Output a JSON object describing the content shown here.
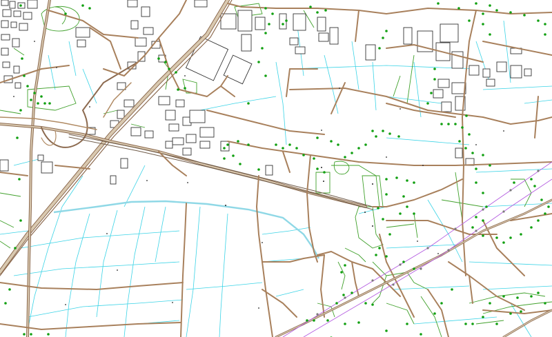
{
  "map": {
    "colors": {
      "background": "#ffffff",
      "road_casing": "#8c6a4f",
      "road_fill": "#d9c9b0",
      "major_road": "#b08a63",
      "minor_road": "#a8805c",
      "canal": "#8fd8e6",
      "ditch": "#39d3e6",
      "vegetation": "#3fa02a",
      "tree": "#12a012",
      "power_line": "#b45ce0",
      "building_outline": "#333333"
    },
    "layers": [
      "buildings",
      "roads",
      "railway",
      "canal",
      "ditches",
      "hedgerows",
      "trees",
      "power-lines"
    ],
    "labels": []
  }
}
